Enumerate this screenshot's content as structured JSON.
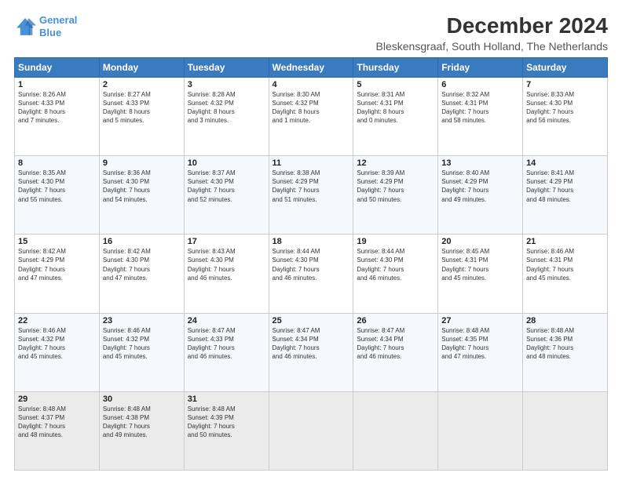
{
  "logo": {
    "line1": "General",
    "line2": "Blue"
  },
  "title": "December 2024",
  "subtitle": "Bleskensgraaf, South Holland, The Netherlands",
  "days_of_week": [
    "Sunday",
    "Monday",
    "Tuesday",
    "Wednesday",
    "Thursday",
    "Friday",
    "Saturday"
  ],
  "weeks": [
    [
      {
        "day": "1",
        "text": "Sunrise: 8:26 AM\nSunset: 4:33 PM\nDaylight: 8 hours\nand 7 minutes."
      },
      {
        "day": "2",
        "text": "Sunrise: 8:27 AM\nSunset: 4:33 PM\nDaylight: 8 hours\nand 5 minutes."
      },
      {
        "day": "3",
        "text": "Sunrise: 8:28 AM\nSunset: 4:32 PM\nDaylight: 8 hours\nand 3 minutes."
      },
      {
        "day": "4",
        "text": "Sunrise: 8:30 AM\nSunset: 4:32 PM\nDaylight: 8 hours\nand 1 minute."
      },
      {
        "day": "5",
        "text": "Sunrise: 8:31 AM\nSunset: 4:31 PM\nDaylight: 8 hours\nand 0 minutes."
      },
      {
        "day": "6",
        "text": "Sunrise: 8:32 AM\nSunset: 4:31 PM\nDaylight: 7 hours\nand 58 minutes."
      },
      {
        "day": "7",
        "text": "Sunrise: 8:33 AM\nSunset: 4:30 PM\nDaylight: 7 hours\nand 56 minutes."
      }
    ],
    [
      {
        "day": "8",
        "text": "Sunrise: 8:35 AM\nSunset: 4:30 PM\nDaylight: 7 hours\nand 55 minutes."
      },
      {
        "day": "9",
        "text": "Sunrise: 8:36 AM\nSunset: 4:30 PM\nDaylight: 7 hours\nand 54 minutes."
      },
      {
        "day": "10",
        "text": "Sunrise: 8:37 AM\nSunset: 4:30 PM\nDaylight: 7 hours\nand 52 minutes."
      },
      {
        "day": "11",
        "text": "Sunrise: 8:38 AM\nSunset: 4:29 PM\nDaylight: 7 hours\nand 51 minutes."
      },
      {
        "day": "12",
        "text": "Sunrise: 8:39 AM\nSunset: 4:29 PM\nDaylight: 7 hours\nand 50 minutes."
      },
      {
        "day": "13",
        "text": "Sunrise: 8:40 AM\nSunset: 4:29 PM\nDaylight: 7 hours\nand 49 minutes."
      },
      {
        "day": "14",
        "text": "Sunrise: 8:41 AM\nSunset: 4:29 PM\nDaylight: 7 hours\nand 48 minutes."
      }
    ],
    [
      {
        "day": "15",
        "text": "Sunrise: 8:42 AM\nSunset: 4:29 PM\nDaylight: 7 hours\nand 47 minutes."
      },
      {
        "day": "16",
        "text": "Sunrise: 8:42 AM\nSunset: 4:30 PM\nDaylight: 7 hours\nand 47 minutes."
      },
      {
        "day": "17",
        "text": "Sunrise: 8:43 AM\nSunset: 4:30 PM\nDaylight: 7 hours\nand 46 minutes."
      },
      {
        "day": "18",
        "text": "Sunrise: 8:44 AM\nSunset: 4:30 PM\nDaylight: 7 hours\nand 46 minutes."
      },
      {
        "day": "19",
        "text": "Sunrise: 8:44 AM\nSunset: 4:30 PM\nDaylight: 7 hours\nand 46 minutes."
      },
      {
        "day": "20",
        "text": "Sunrise: 8:45 AM\nSunset: 4:31 PM\nDaylight: 7 hours\nand 45 minutes."
      },
      {
        "day": "21",
        "text": "Sunrise: 8:46 AM\nSunset: 4:31 PM\nDaylight: 7 hours\nand 45 minutes."
      }
    ],
    [
      {
        "day": "22",
        "text": "Sunrise: 8:46 AM\nSunset: 4:32 PM\nDaylight: 7 hours\nand 45 minutes."
      },
      {
        "day": "23",
        "text": "Sunrise: 8:46 AM\nSunset: 4:32 PM\nDaylight: 7 hours\nand 45 minutes."
      },
      {
        "day": "24",
        "text": "Sunrise: 8:47 AM\nSunset: 4:33 PM\nDaylight: 7 hours\nand 46 minutes."
      },
      {
        "day": "25",
        "text": "Sunrise: 8:47 AM\nSunset: 4:34 PM\nDaylight: 7 hours\nand 46 minutes."
      },
      {
        "day": "26",
        "text": "Sunrise: 8:47 AM\nSunset: 4:34 PM\nDaylight: 7 hours\nand 46 minutes."
      },
      {
        "day": "27",
        "text": "Sunrise: 8:48 AM\nSunset: 4:35 PM\nDaylight: 7 hours\nand 47 minutes."
      },
      {
        "day": "28",
        "text": "Sunrise: 8:48 AM\nSunset: 4:36 PM\nDaylight: 7 hours\nand 48 minutes."
      }
    ],
    [
      {
        "day": "29",
        "text": "Sunrise: 8:48 AM\nSunset: 4:37 PM\nDaylight: 7 hours\nand 48 minutes."
      },
      {
        "day": "30",
        "text": "Sunrise: 8:48 AM\nSunset: 4:38 PM\nDaylight: 7 hours\nand 49 minutes."
      },
      {
        "day": "31",
        "text": "Sunrise: 8:48 AM\nSunset: 4:39 PM\nDaylight: 7 hours\nand 50 minutes."
      },
      {
        "day": "",
        "text": ""
      },
      {
        "day": "",
        "text": ""
      },
      {
        "day": "",
        "text": ""
      },
      {
        "day": "",
        "text": ""
      }
    ]
  ]
}
